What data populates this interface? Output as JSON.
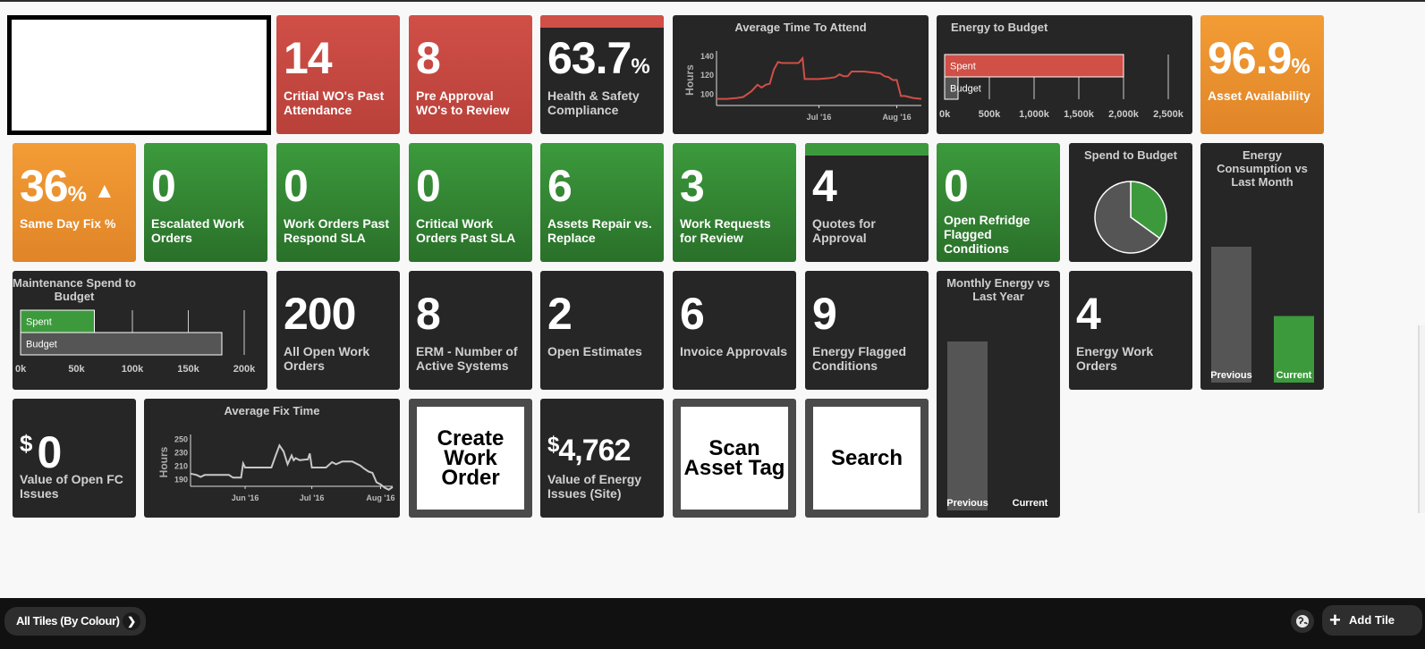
{
  "tiles": {
    "critical_wo_past_attendance": {
      "value": "14",
      "label": "Critial WO's Past Attendance",
      "color": "#c94a43"
    },
    "pre_approval": {
      "value": "8",
      "label": "Pre Approval WO's to Review",
      "color": "#c94a43"
    },
    "hs_compliance": {
      "value": "63.7",
      "unit": "%",
      "label": "Health & Safety Compliance",
      "status_color": "#d04f47"
    },
    "asset_availability": {
      "value": "96.9",
      "unit": "%",
      "label": "Asset Availability",
      "color": "#f0962f"
    },
    "same_day_fix": {
      "value": "36",
      "unit": "%",
      "trend": "▲",
      "label": "Same Day Fix %",
      "color": "#f0962f"
    },
    "escalated": {
      "value": "0",
      "label": "Escalated Work Orders"
    },
    "past_respond_sla": {
      "value": "0",
      "label": "Work Orders Past Respond SLA"
    },
    "critical_past_sla": {
      "value": "0",
      "label": "Critical Work Orders Past SLA"
    },
    "repair_vs_replace": {
      "value": "6",
      "label": "Assets Repair vs. Replace"
    },
    "work_requests": {
      "value": "3",
      "label": "Work Requests for Review"
    },
    "quotes": {
      "value": "4",
      "label": "Quotes for Approval",
      "status_color": "#3c9a3c"
    },
    "refridge": {
      "value": "0",
      "label": "Open Refridge Flagged Conditions"
    },
    "all_open_wo": {
      "value": "200",
      "label": "All Open Work Orders"
    },
    "erm": {
      "value": "8",
      "label": "ERM - Number of Active Systems"
    },
    "open_estimates": {
      "value": "2",
      "label": "Open Estimates"
    },
    "invoice_approvals": {
      "value": "6",
      "label": "Invoice Approvals"
    },
    "energy_flagged": {
      "value": "9",
      "label": "Energy Flagged Conditions"
    },
    "energy_wo": {
      "value": "4",
      "label": "Energy Work Orders"
    },
    "open_fc": {
      "currency": "$",
      "value": "0",
      "label": "Value of Open FC Issues"
    },
    "energy_issues": {
      "currency": "$",
      "value": "4,762",
      "label": "Value of Energy Issues (Site)"
    }
  },
  "actions": {
    "create_wo": "Create Work Order",
    "scan_tag": "Scan Asset Tag",
    "search": "Search"
  },
  "bottombar": {
    "filter_label": "All Tiles (By Colour)",
    "add_tile_label": "Add Tile"
  },
  "chart_data": [
    {
      "id": "avg_time_attend",
      "type": "line",
      "title": "Average Time To Attend",
      "ylabel": "Hours",
      "ylim": [
        88,
        142
      ],
      "yticks": [
        100,
        120,
        140
      ],
      "xtick_labels": [
        "Jul '16",
        "Aug '16"
      ],
      "xtick_positions": [
        0.5,
        0.88
      ],
      "color": "#d04f47",
      "x": [
        0,
        0.05,
        0.1,
        0.13,
        0.17,
        0.2,
        0.22,
        0.24,
        0.26,
        0.28,
        0.3,
        0.32,
        0.34,
        0.4,
        0.42,
        0.43,
        0.45,
        0.5,
        0.55,
        0.58,
        0.6,
        0.62,
        0.64,
        0.66,
        0.68,
        0.72,
        0.8,
        0.82,
        0.84,
        0.86,
        0.88,
        0.9,
        0.92,
        0.96,
        1.0
      ],
      "values": [
        95,
        95,
        96,
        97,
        103,
        110,
        107,
        110,
        111,
        126,
        134,
        133,
        133,
        133,
        138,
        116,
        116,
        116,
        117,
        118,
        121,
        119,
        119,
        124,
        124,
        124,
        122,
        119,
        118,
        115,
        115,
        98,
        98,
        96,
        95
      ]
    },
    {
      "id": "avg_fix_time",
      "type": "line",
      "title": "Average Fix Time",
      "ylabel": "Hours",
      "ylim": [
        180,
        252
      ],
      "yticks": [
        190,
        210,
        230,
        250
      ],
      "xtick_labels": [
        "Jun '16",
        "Jul '16",
        "Aug '16"
      ],
      "xtick_positions": [
        0.27,
        0.6,
        0.94
      ],
      "color": "#c8c8c8",
      "x": [
        0,
        0.03,
        0.05,
        0.07,
        0.1,
        0.15,
        0.19,
        0.21,
        0.24,
        0.25,
        0.26,
        0.27,
        0.3,
        0.35,
        0.4,
        0.42,
        0.44,
        0.46,
        0.48,
        0.5,
        0.51,
        0.52,
        0.54,
        0.57,
        0.58,
        0.59,
        0.6,
        0.62,
        0.65,
        0.67,
        0.7,
        0.72,
        0.75,
        0.8,
        0.84,
        0.86,
        0.88,
        0.9,
        0.92,
        0.94,
        0.96,
        0.98,
        1.0
      ],
      "values": [
        199,
        197,
        194,
        197,
        197,
        197,
        197,
        193,
        193,
        193,
        214,
        208,
        208,
        208,
        208,
        225,
        241,
        232,
        213,
        226,
        219,
        222,
        219,
        220,
        220,
        229,
        208,
        208,
        208,
        208,
        216,
        213,
        217,
        217,
        211,
        206,
        202,
        200,
        186,
        183,
        178,
        175,
        179
      ]
    },
    {
      "id": "energy_to_budget",
      "type": "bar",
      "orientation": "horizontal",
      "title": "Energy to Budget",
      "categories": [
        "Spent",
        "Budget"
      ],
      "values": [
        2000000,
        150000
      ],
      "colors": [
        "#d04f47",
        "#555555"
      ],
      "xlim": [
        0,
        2500000
      ],
      "xtick_labels": [
        "0k",
        "500k",
        "1,000k",
        "1,500k",
        "2,000k",
        "2,500k"
      ]
    },
    {
      "id": "maintenance_spend",
      "type": "bar",
      "orientation": "horizontal",
      "title": "Maintenance Spend to Budget",
      "categories": [
        "Spent",
        "Budget"
      ],
      "values": [
        66000,
        180000
      ],
      "colors": [
        "#3c9a3c",
        "#555555"
      ],
      "xlim": [
        0,
        200000
      ],
      "xtick_labels": [
        "0k",
        "50k",
        "100k",
        "150k",
        "200k"
      ]
    },
    {
      "id": "spend_to_budget",
      "type": "pie",
      "title": "Spend to Budget",
      "categories": [
        "Spent",
        "Remaining"
      ],
      "values": [
        35,
        65
      ],
      "colors": [
        "#3c9a3c",
        "#555555"
      ]
    },
    {
      "id": "energy_vs_last_month",
      "type": "bar",
      "title": "Energy Consumption vs Last Month",
      "categories": [
        "Previous",
        "Current"
      ],
      "values": [
        100,
        49
      ],
      "colors": [
        "#555555",
        "#3c9a3c"
      ]
    },
    {
      "id": "monthly_energy_vs_last_year",
      "type": "bar",
      "title": "Monthly Energy vs Last Year",
      "categories": [
        "Previous",
        "Current"
      ],
      "values": [
        100,
        0
      ],
      "colors": [
        "#555555",
        "#3c9a3c"
      ]
    }
  ]
}
